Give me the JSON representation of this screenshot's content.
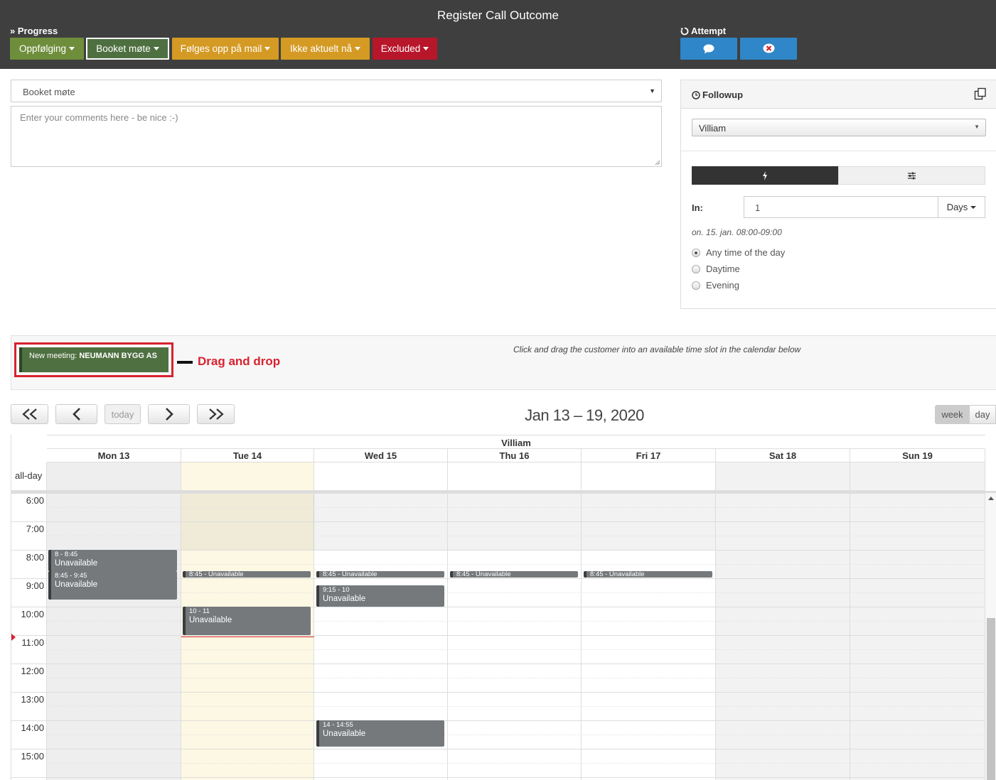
{
  "header": {
    "title": "Register Call Outcome",
    "progress_label": "» Progress",
    "attempt_label": "Attempt",
    "progress_buttons": [
      {
        "label": "Oppfølging",
        "color": "#6f8e3c"
      },
      {
        "label": "Booket møte",
        "color": "#4e7041"
      },
      {
        "label": "Følges opp på mail",
        "color": "#d49a24"
      },
      {
        "label": "Ikke aktuelt nå",
        "color": "#d49a24"
      },
      {
        "label": "Excluded",
        "color": "#b8162b"
      }
    ],
    "attempt_buttons": [
      {
        "icon": "speech-bubble-icon",
        "color": "#2f86c8"
      },
      {
        "icon": "no-phone-icon",
        "color": "#2f86c8"
      }
    ]
  },
  "form": {
    "status_value": "Booket møte",
    "comment_placeholder": "Enter your comments here - be nice :-)"
  },
  "followup": {
    "title": "Followup",
    "user": "Villiam",
    "in_label": "In:",
    "in_value": "1",
    "unit": "Days",
    "when_text": "on. 15. jan. 08:00-09:00",
    "options": [
      "Any time of the day",
      "Daytime",
      "Evening"
    ],
    "selected_option": "Any time of the day"
  },
  "drag": {
    "item_prefix": "New meeting: ",
    "item_customer": "NEUMANN BYGG AS",
    "annotation": "Drag and drop",
    "hint": "Click and drag the customer into an available time slot in the calendar below"
  },
  "calendar": {
    "range": "Jan 13 – 19, 2020",
    "today_label": "today",
    "view_week": "week",
    "view_day": "day",
    "resource": "Villiam",
    "allday_label": "all-day",
    "days": [
      "Mon 13",
      "Tue 14",
      "Wed 15",
      "Thu 16",
      "Fri 17",
      "Sat 18",
      "Sun 19"
    ],
    "hours": [
      "6:00",
      "7:00",
      "8:00",
      "9:00",
      "10:00",
      "11:00",
      "12:00",
      "13:00",
      "14:00",
      "15:00"
    ],
    "events": [
      {
        "day": 0,
        "time": "8 - 8:45",
        "title": "Unavailable"
      },
      {
        "day": 0,
        "time": "8:45 - 9:45",
        "title": "Unavailable"
      },
      {
        "day": 1,
        "time": "8:45 - Unavailable",
        "title": ""
      },
      {
        "day": 1,
        "time": "10 - 11",
        "title": "Unavailable"
      },
      {
        "day": 2,
        "time": "8:45 - Unavailable",
        "title": ""
      },
      {
        "day": 2,
        "time": "9:15 - 10",
        "title": "Unavailable"
      },
      {
        "day": 2,
        "time": "14 - 14:55",
        "title": "Unavailable"
      },
      {
        "day": 3,
        "time": "8:45 - Unavailable",
        "title": ""
      },
      {
        "day": 4,
        "time": "8:45 - Unavailable",
        "title": ""
      }
    ]
  }
}
